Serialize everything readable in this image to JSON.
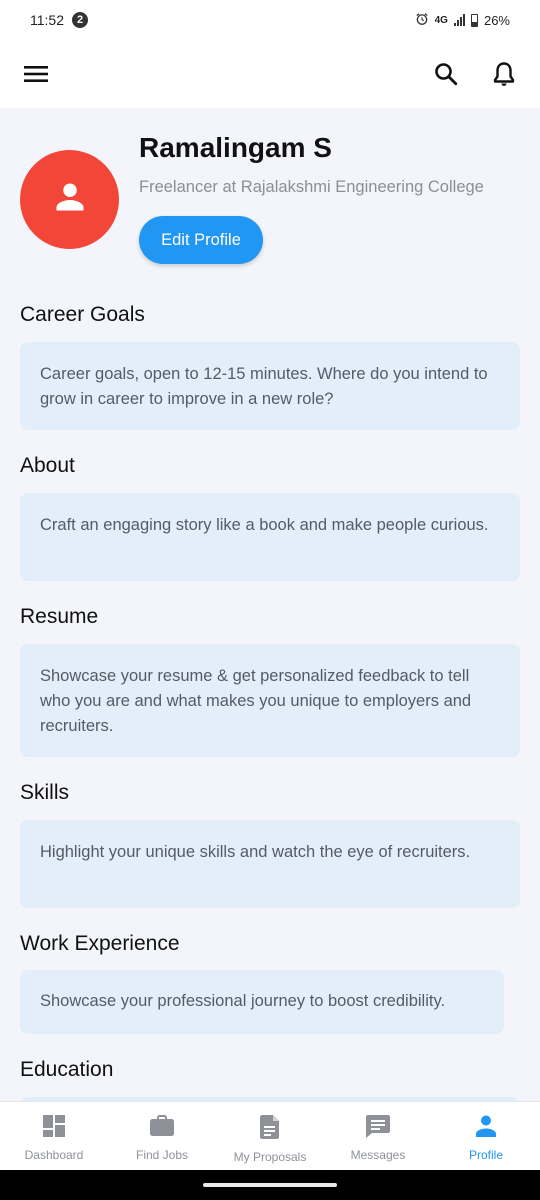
{
  "status_bar": {
    "time": "11:52",
    "notification_count": "2",
    "network": "4G",
    "battery": "26%"
  },
  "profile": {
    "name": "Ramalingam S",
    "subtitle": "Freelancer at Rajalakshmi Engineering College",
    "edit_button": "Edit Profile",
    "avatar_color": "#f24738"
  },
  "sections": [
    {
      "title": "Career Goals",
      "text": "Career goals, open to 12-15 minutes. Where do you intend to grow in career to improve in a new role?"
    },
    {
      "title": "About",
      "text": "Craft an engaging story like a book and make people curious."
    },
    {
      "title": "Resume",
      "text": "Showcase your resume & get personalized feedback to tell who you are and what makes you unique to employers and recruiters."
    },
    {
      "title": "Skills",
      "text": "Highlight your unique skills and watch the eye of recruiters."
    },
    {
      "title": "Work Experience",
      "text": "Showcase your professional journey to boost credibility."
    },
    {
      "title": "Education",
      "text": ""
    }
  ],
  "bottom_nav": [
    {
      "label": "Dashboard",
      "icon": "dashboard-icon"
    },
    {
      "label": "Find Jobs",
      "icon": "briefcase-icon"
    },
    {
      "label": "My Proposals",
      "icon": "document-icon"
    },
    {
      "label": "Messages",
      "icon": "message-icon"
    },
    {
      "label": "Profile",
      "icon": "person-icon",
      "active": true
    }
  ],
  "colors": {
    "accent": "#2196f3",
    "card_bg": "#e3eefb",
    "page_bg": "#f3f5fa"
  }
}
